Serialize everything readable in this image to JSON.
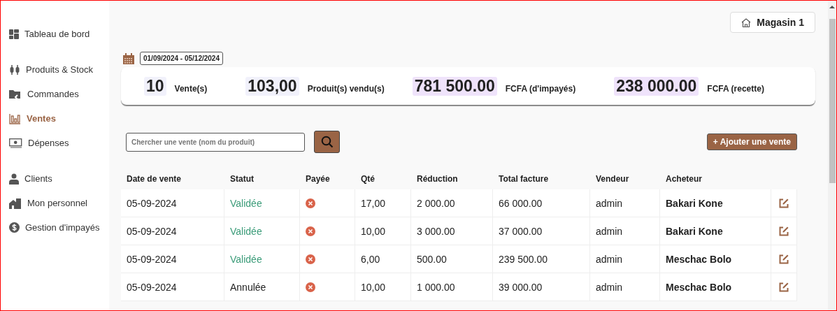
{
  "sidebar": {
    "items": [
      {
        "label": "Tableau de bord",
        "selected": false
      },
      {
        "label": "Produits & Stock",
        "selected": false
      },
      {
        "label": "Commandes",
        "selected": false
      },
      {
        "label": "Ventes",
        "selected": true
      },
      {
        "label": "Dépenses",
        "selected": false
      },
      {
        "label": "Clients",
        "selected": false
      },
      {
        "label": "Mon personnel",
        "selected": false
      },
      {
        "label": "Gestion d'impayés",
        "selected": false
      }
    ]
  },
  "store_button": {
    "label": "Magasin 1"
  },
  "date_range": "01/09/2024 - 05/12/2024",
  "stats": [
    {
      "value": "10",
      "label": "Vente(s)",
      "color": "#f1f1fb"
    },
    {
      "value": "103,00",
      "label": "Produit(s) vendu(s)",
      "color": "#f1f1fb"
    },
    {
      "value": "781 500.00",
      "label": "FCFA (d'impayés)",
      "color": "#efe3fb"
    },
    {
      "value": "238 000.00",
      "label": "FCFA (recette)",
      "color": "#efe3fb"
    }
  ],
  "search": {
    "placeholder": "Chercher une vente (nom du produit)"
  },
  "add_button": "+ Ajouter une vente",
  "table": {
    "columns": [
      "Date de vente",
      "Statut",
      "Payée",
      "Qté",
      "Réduction",
      "Total facture",
      "Vendeur",
      "Acheteur"
    ],
    "rows": [
      {
        "date": "05-09-2024",
        "status": "Validée",
        "kind": "validated",
        "paid": false,
        "qty": "17,00",
        "discount": "2 000.00",
        "total": "66 000.00",
        "seller": "admin",
        "buyer": "Bakari Kone"
      },
      {
        "date": "05-09-2024",
        "status": "Validée",
        "kind": "validated",
        "paid": false,
        "qty": "10,00",
        "discount": "3 000.00",
        "total": "37 000.00",
        "seller": "admin",
        "buyer": "Bakari Kone"
      },
      {
        "date": "05-09-2024",
        "status": "Validée",
        "kind": "validated",
        "paid": false,
        "qty": "6,00",
        "discount": "500.00",
        "total": "239 500.00",
        "seller": "admin",
        "buyer": "Meschac Bolo"
      },
      {
        "date": "05-09-2024",
        "status": "Annulée",
        "kind": "cancelled",
        "paid": false,
        "qty": "10,00",
        "discount": "1 000.00",
        "total": "39 000.00",
        "seller": "admin",
        "buyer": "Meschac Bolo"
      }
    ]
  }
}
